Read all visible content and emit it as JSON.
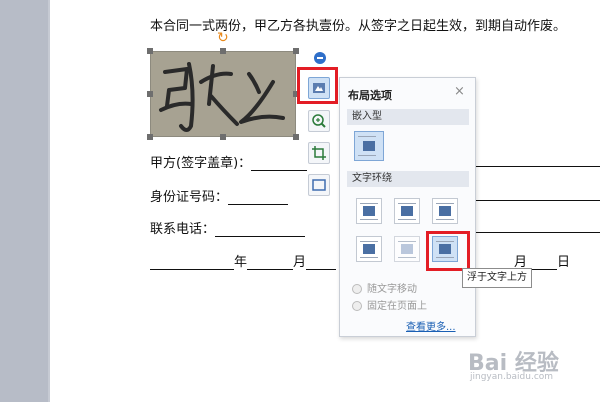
{
  "document": {
    "line1": "本合同一式两份，甲乙方各执壹份。从签字之日起生效，到期自动作废。",
    "party_a_label": "甲方(签字盖章)：",
    "id_label": "身份证号码：",
    "phone_label": "联系电话：",
    "year": "年",
    "month": "月",
    "month2": "月",
    "day": "日"
  },
  "signature": {
    "text": "张三"
  },
  "popup": {
    "title": "布局选项",
    "close": "×",
    "section_inline": "嵌入型",
    "section_wrap": "文字环绕",
    "radio_move": "随文字移动",
    "radio_fixed": "固定在页面上",
    "more_link": "查看更多..."
  },
  "tooltip": "浮于文字上方",
  "watermark": {
    "brand": "Bai 经验",
    "url": "jingyan.baidu.com"
  },
  "colors": {
    "highlight": "#e31d25",
    "accent": "#2f6fc9",
    "link": "#1a5fb4"
  },
  "icons": {
    "layout": "layout-options-icon",
    "zoom": "zoom-icon",
    "crop": "crop-icon",
    "frame": "frame-icon",
    "rotate": "rotate-handle-icon"
  }
}
